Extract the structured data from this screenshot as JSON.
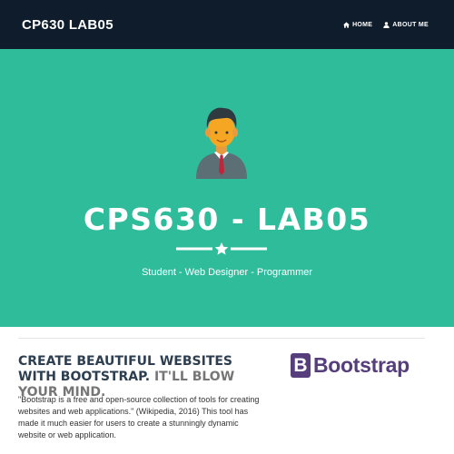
{
  "navbar": {
    "brand": "CP630 LAB05",
    "links": [
      {
        "label": "HOME",
        "icon": "home-icon"
      },
      {
        "label": "ABOUT ME",
        "icon": "user-icon"
      }
    ]
  },
  "hero": {
    "avatar_icon": "person-avatar-icon",
    "title": "CPS630 - LAB05",
    "divider_icon": "star-icon",
    "subtitle": "Student - Web Designer - Programmer"
  },
  "content": {
    "headline_main": "CREATE BEAUTIFUL WEBSITES WITH BOOTSTRAP.",
    "headline_accent": "IT'LL BLOW YOUR MIND.",
    "paragraph": "\"Bootstrap is a free and open-source collection of tools for creating websites and web applications.\" (Wikipedia, 2016) This tool has made it much easier for users to create a stunningly dynamic website or web application.",
    "logo_letter": "B",
    "logo_word": "Bootstrap"
  },
  "colors": {
    "navbar_bg": "#0e1c2b",
    "hero_bg": "#2ebc9b",
    "bootstrap_purple": "#563d7c"
  }
}
